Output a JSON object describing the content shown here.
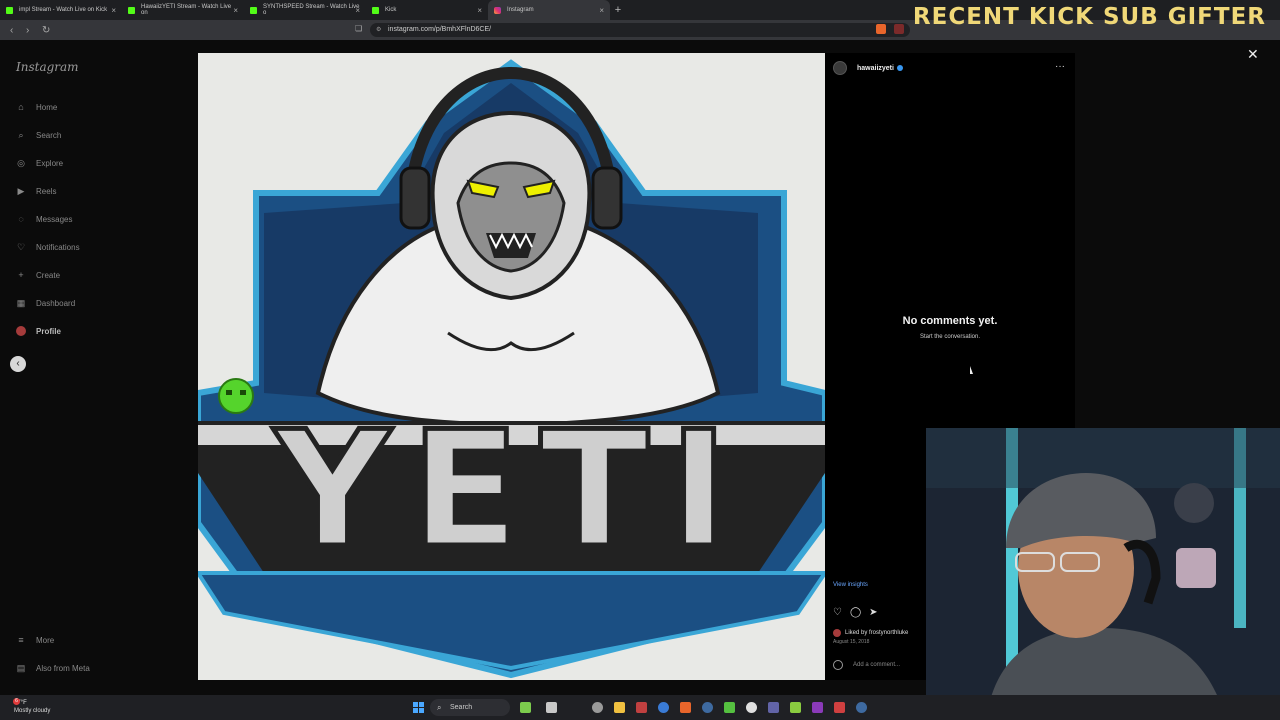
{
  "browser": {
    "tabs": [
      {
        "label": "impl Stream - Watch Live on Kick",
        "favicon": "kick-icon"
      },
      {
        "label": "HawaiizYETI Stream - Watch Live on",
        "favicon": "kick-icon"
      },
      {
        "label": "SYNTHSPEED Stream - Watch Live o",
        "favicon": "kick-icon"
      },
      {
        "label": "Kick",
        "favicon": "kick-icon"
      },
      {
        "label": "Instagram",
        "favicon": "instagram-icon",
        "active": true
      }
    ],
    "url": "instagram.com/p/BmhXFlnD6CE/"
  },
  "overlay": {
    "title": "RECENT KICK SUB GIFTER"
  },
  "sidebar": {
    "logo": "Instagram",
    "items": [
      {
        "label": "Home",
        "icon": "home-icon"
      },
      {
        "label": "Search",
        "icon": "search-icon"
      },
      {
        "label": "Explore",
        "icon": "compass-icon"
      },
      {
        "label": "Reels",
        "icon": "reels-icon"
      },
      {
        "label": "Messages",
        "icon": "messenger-icon"
      },
      {
        "label": "Notifications",
        "icon": "heart-icon"
      },
      {
        "label": "Create",
        "icon": "plus-icon"
      },
      {
        "label": "Dashboard",
        "icon": "dashboard-icon"
      },
      {
        "label": "Profile",
        "icon": "avatar"
      }
    ],
    "more": "More",
    "meta": "Also from Meta"
  },
  "post": {
    "logo_text": "YETI",
    "username": "hawaiizyeti",
    "no_comments": "No comments yet.",
    "start_conversation": "Start the conversation.",
    "view_insights": "View insights",
    "liked_by": "Liked by frostynorthluke",
    "date": "August 15, 2018",
    "add_comment": "Add a comment..."
  },
  "taskbar": {
    "weather_temp": "77°F",
    "weather_desc": "Mostly cloudy",
    "search": "Search",
    "notification_count": "6"
  }
}
